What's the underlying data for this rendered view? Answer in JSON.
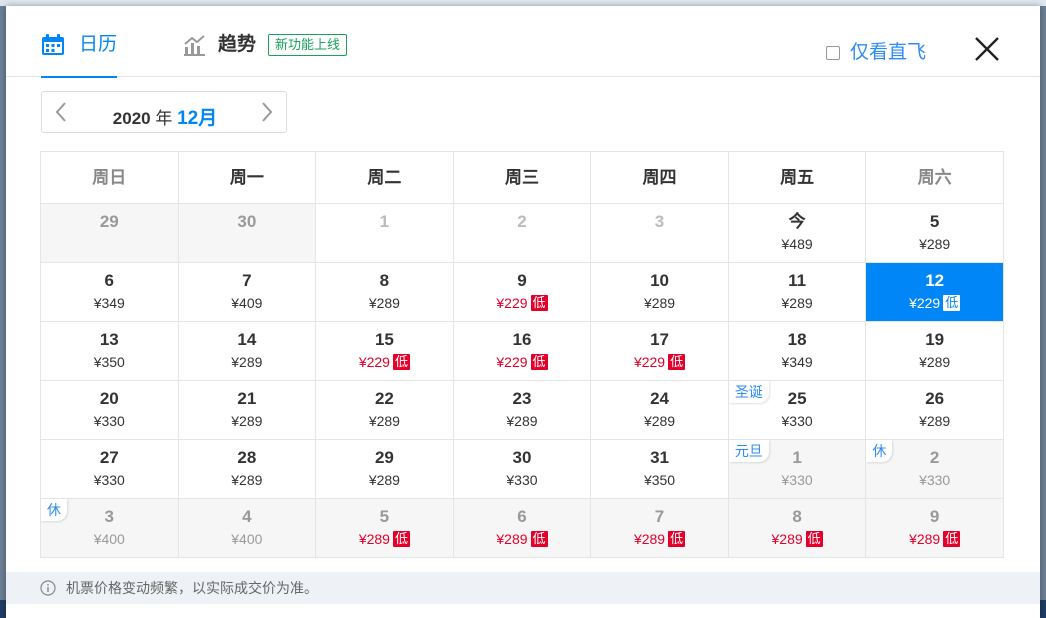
{
  "tabs": [
    {
      "label": "日历",
      "icon": "calendar-icon",
      "active": true
    },
    {
      "label": "趋势",
      "icon": "trend-chart-icon",
      "active": false,
      "badge": "新功能上线"
    }
  ],
  "direct_only_label": "仅看直飞",
  "month_nav": {
    "year": "2020",
    "year_suffix": "年",
    "month": "12月"
  },
  "weekdays": [
    "周日",
    "周一",
    "周二",
    "周三",
    "周四",
    "周五",
    "周六"
  ],
  "low_tag": "低",
  "rows": [
    [
      {
        "day": "29",
        "price": "",
        "state": "prev"
      },
      {
        "day": "30",
        "price": "",
        "state": "prev"
      },
      {
        "day": "1",
        "price": "",
        "state": "past"
      },
      {
        "day": "2",
        "price": "",
        "state": "past"
      },
      {
        "day": "3",
        "price": "",
        "state": "past"
      },
      {
        "day": "今",
        "price": "¥489"
      },
      {
        "day": "5",
        "price": "¥289"
      }
    ],
    [
      {
        "day": "6",
        "price": "¥349"
      },
      {
        "day": "7",
        "price": "¥409"
      },
      {
        "day": "8",
        "price": "¥289"
      },
      {
        "day": "9",
        "price": "¥229",
        "low": true
      },
      {
        "day": "10",
        "price": "¥289"
      },
      {
        "day": "11",
        "price": "¥289"
      },
      {
        "day": "12",
        "price": "¥229",
        "low": true,
        "selected": true
      }
    ],
    [
      {
        "day": "13",
        "price": "¥350"
      },
      {
        "day": "14",
        "price": "¥289"
      },
      {
        "day": "15",
        "price": "¥229",
        "low": true
      },
      {
        "day": "16",
        "price": "¥229",
        "low": true
      },
      {
        "day": "17",
        "price": "¥229",
        "low": true
      },
      {
        "day": "18",
        "price": "¥349"
      },
      {
        "day": "19",
        "price": "¥289"
      }
    ],
    [
      {
        "day": "20",
        "price": "¥330"
      },
      {
        "day": "21",
        "price": "¥289"
      },
      {
        "day": "22",
        "price": "¥289"
      },
      {
        "day": "23",
        "price": "¥289"
      },
      {
        "day": "24",
        "price": "¥289"
      },
      {
        "day": "25",
        "price": "¥330",
        "holiday": "圣诞"
      },
      {
        "day": "26",
        "price": "¥289"
      }
    ],
    [
      {
        "day": "27",
        "price": "¥330"
      },
      {
        "day": "28",
        "price": "¥289"
      },
      {
        "day": "29",
        "price": "¥289"
      },
      {
        "day": "30",
        "price": "¥330"
      },
      {
        "day": "31",
        "price": "¥350"
      },
      {
        "day": "1",
        "price": "¥330",
        "state": "next",
        "holiday": "元旦"
      },
      {
        "day": "2",
        "price": "¥330",
        "state": "next",
        "holiday": "休"
      }
    ],
    [
      {
        "day": "3",
        "price": "¥400",
        "state": "next",
        "holiday": "休"
      },
      {
        "day": "4",
        "price": "¥400",
        "state": "next"
      },
      {
        "day": "5",
        "price": "¥289",
        "state": "next",
        "low": true
      },
      {
        "day": "6",
        "price": "¥289",
        "state": "next",
        "low": true
      },
      {
        "day": "7",
        "price": "¥289",
        "state": "next",
        "low": true
      },
      {
        "day": "8",
        "price": "¥289",
        "state": "next",
        "low": true
      },
      {
        "day": "9",
        "price": "¥289",
        "state": "next",
        "low": true
      }
    ]
  ],
  "footer_note": "机票价格变动频繁，以实际成交价为准。",
  "colors": {
    "accent": "#0086f6",
    "low_price": "#e3002b",
    "badge_green": "#19a05c"
  }
}
